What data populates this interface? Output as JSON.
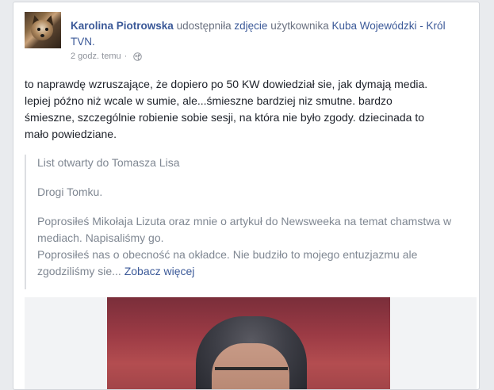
{
  "post": {
    "actor": "Karolina Piotrowska",
    "action": "udostępniła",
    "object_link": "zdjęcie",
    "object_owner_prefix": "użytkownika",
    "owner": "Kuba Wojewódzki - Król TVN.",
    "time": "2 godz. temu",
    "privacy_icon": "globe-icon",
    "body_lines": [
      "to naprawdę wzruszające, że dopiero po 50 KW dowiedział sie, jak dymają media.",
      "lepiej późno niż wcale w sumie, ale...śmieszne bardziej niz smutne. bardzo",
      "śmieszne, szczególnie robienie sobie sesji, na która nie było zgody. dziecinada to",
      "mało powiedziane."
    ],
    "quote": {
      "title": "List otwarty do Tomasza Lisa",
      "greeting": "Drogi Tomku.",
      "lines": [
        "Poprosiłeś Mikołaja Lizuta oraz mnie o artykuł do Newsweeka na temat chamstwa w",
        "mediach. Napisaliśmy go.",
        "Poprosiłeś nas o obecność na okładce. Nie budziło to mojego entuzjazmu ale"
      ],
      "last_line": "zgodziliśmy sie...",
      "see_more": "Zobacz więcej"
    }
  },
  "colors": {
    "link": "#3b5998",
    "text": "#1d2129",
    "muted": "#90949c",
    "quote_text": "#7f8792"
  }
}
